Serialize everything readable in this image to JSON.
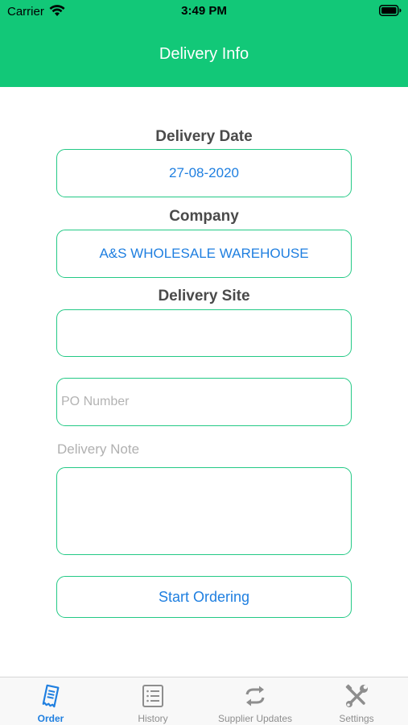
{
  "status_bar": {
    "carrier": "Carrier",
    "time": "3:49 PM"
  },
  "nav": {
    "title": "Delivery Info"
  },
  "form": {
    "delivery_date": {
      "label": "Delivery Date",
      "value": "27-08-2020"
    },
    "company": {
      "label": "Company",
      "value": "A&S WHOLESALE WAREHOUSE"
    },
    "delivery_site": {
      "label": "Delivery Site",
      "value": ""
    },
    "po_number": {
      "placeholder": "PO Number"
    },
    "delivery_note": {
      "label": "Delivery Note",
      "value": ""
    },
    "start_button": "Start Ordering"
  },
  "tab_bar": {
    "tabs": [
      {
        "label": "Order",
        "icon": "order-receipt-icon",
        "active": true
      },
      {
        "label": "History",
        "icon": "history-list-icon",
        "active": false
      },
      {
        "label": "Supplier Updates",
        "icon": "refresh-arrows-icon",
        "active": false
      },
      {
        "label": "Settings",
        "icon": "tools-wrench-icon",
        "active": false
      }
    ]
  },
  "colors": {
    "brand_green": "#12c878",
    "field_border": "#23c985",
    "accent_blue": "#1f7fe0"
  }
}
